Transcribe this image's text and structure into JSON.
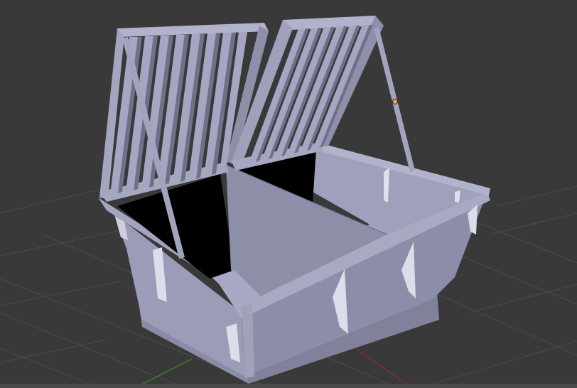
{
  "viewport": {
    "background_color": "#393939",
    "grid_color": "#4b4b4b",
    "x_axis_color": "#7a3030",
    "y_axis_color": "#3f7a30",
    "model_color": "#9a9cb8",
    "interior_color": "#000000",
    "selected_vertex_color": "#f0a060",
    "objects": [
      {
        "name": "dumpster-body"
      },
      {
        "name": "left-lid-open"
      },
      {
        "name": "right-lid-open"
      },
      {
        "name": "left-lid-support-rod"
      },
      {
        "name": "right-lid-support-rod"
      }
    ]
  }
}
